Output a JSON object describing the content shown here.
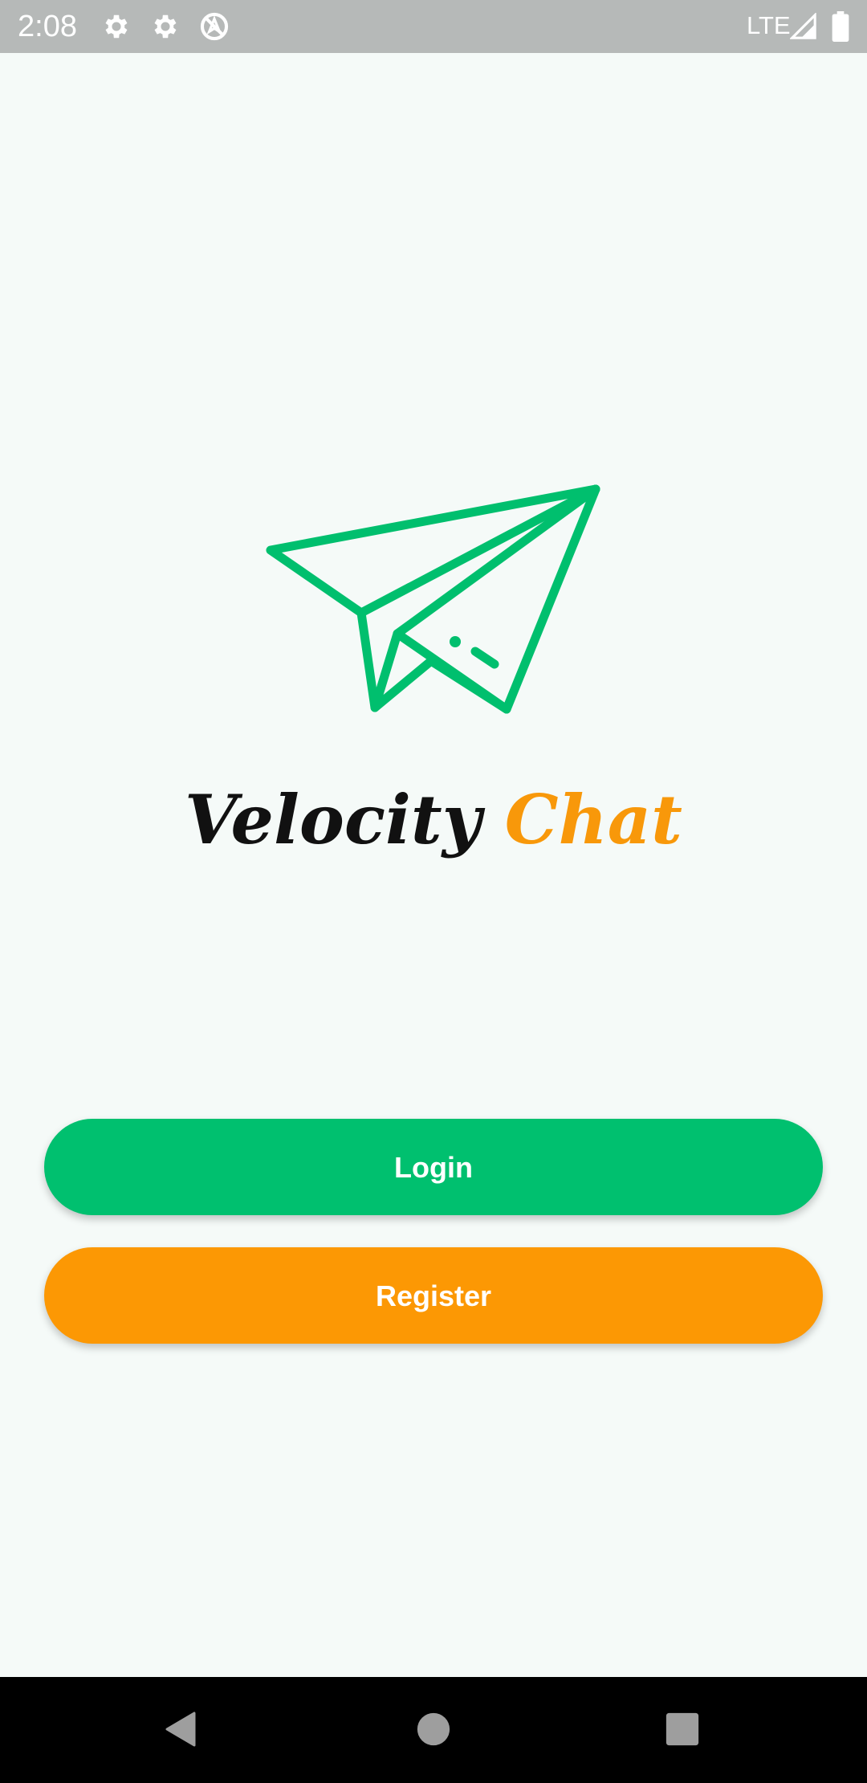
{
  "status_bar": {
    "time": "2:08",
    "network": "LTE",
    "icons": [
      "gear-icon",
      "gear-icon",
      "no-location-icon",
      "signal-icon",
      "battery-icon"
    ]
  },
  "app": {
    "title_part1": "Velocity",
    "title_part2": "Chat",
    "logo_icon": "paper-plane-icon"
  },
  "actions": {
    "login_label": "Login",
    "register_label": "Register"
  },
  "nav_bar": {
    "icons": [
      "back-icon",
      "home-icon",
      "recents-icon"
    ]
  },
  "colors": {
    "brand_green": "#00c06f",
    "brand_orange": "#fc9804",
    "background": "#f5faf8",
    "status_bar": "#b6b9b8",
    "nav_bar": "#000000"
  }
}
